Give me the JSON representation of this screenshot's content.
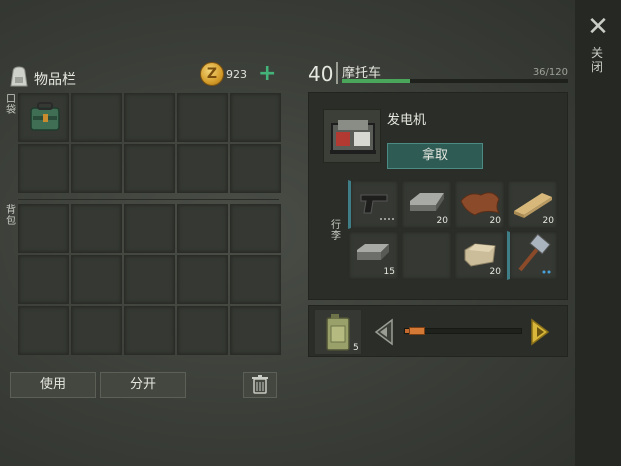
{
  "close": {
    "icon": "close-icon",
    "label": "关闭"
  },
  "inventory": {
    "title": "物品栏",
    "pocket_label": "口袋",
    "backpack_label": "背包",
    "coins": "923",
    "coin_icon": "coin-icon",
    "add_icon": "plus-icon",
    "pocket_items": [
      {
        "name": "toolkit",
        "qty": ""
      }
    ],
    "buttons": {
      "use": "使用",
      "split": "分开",
      "trash_icon": "trash-icon"
    }
  },
  "container": {
    "level": "40",
    "name": "摩托车",
    "capacity": "36/120",
    "capacity_fraction": 0.3,
    "trunk_label": "行李",
    "generator": {
      "name": "发电机",
      "take": "拿取"
    },
    "items": [
      {
        "name": "pistol",
        "qty": ""
      },
      {
        "name": "iron-bar",
        "qty": "20"
      },
      {
        "name": "leather",
        "qty": "20"
      },
      {
        "name": "wood-plank",
        "qty": "20"
      },
      {
        "name": "iron-bar",
        "qty": "15"
      },
      {
        "name": "empty",
        "qty": ""
      },
      {
        "name": "stone-block",
        "qty": "20"
      },
      {
        "name": "sledgehammer",
        "qty": ""
      }
    ]
  },
  "fuel": {
    "item": "fuel-canister",
    "qty": "5",
    "slider_fraction": 0.1
  },
  "colors": {
    "accent_green": "#43b37a",
    "take_button": "#2f5b55",
    "capacity_bar": "#4aa65a",
    "arrow_yellow": "#d9b73a"
  }
}
